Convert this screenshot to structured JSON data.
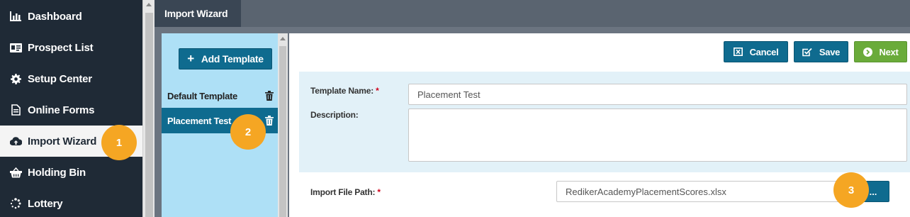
{
  "sidebar": {
    "items": [
      {
        "label": "Dashboard",
        "icon": "bar-chart-icon"
      },
      {
        "label": "Prospect List",
        "icon": "id-card-icon"
      },
      {
        "label": "Setup Center",
        "icon": "gear-icon"
      },
      {
        "label": "Online Forms",
        "icon": "document-icon"
      },
      {
        "label": "Import Wizard",
        "icon": "cloud-upload-icon",
        "active": true
      },
      {
        "label": "Holding Bin",
        "icon": "basket-icon"
      },
      {
        "label": "Lottery",
        "icon": "spinner-icon"
      }
    ]
  },
  "tabs": {
    "active": "Import Wizard"
  },
  "templates": {
    "add_label": "Add Template",
    "items": [
      {
        "label": "Default Template"
      },
      {
        "label": "Placement Test",
        "selected": true
      }
    ]
  },
  "toolbar": {
    "cancel_label": "Cancel",
    "save_label": "Save",
    "next_label": "Next"
  },
  "form": {
    "template_name_label": "Template Name:",
    "template_name_value": "Placement Test",
    "description_label": "Description:",
    "description_value": "",
    "import_path_label": "Import File Path:",
    "import_path_value": "RedikerAcademyPlacementScores.xlsx",
    "browse_label": "...",
    "required_mark": "*"
  },
  "badges": [
    "1",
    "2",
    "3"
  ],
  "colors": {
    "sidebar_bg": "#1f2a36",
    "primary": "#0f6b8f",
    "success": "#6aab3a",
    "badge": "#f5a623",
    "panel_light_blue": "#aee0f6",
    "form_bg": "#e2f1f8"
  }
}
